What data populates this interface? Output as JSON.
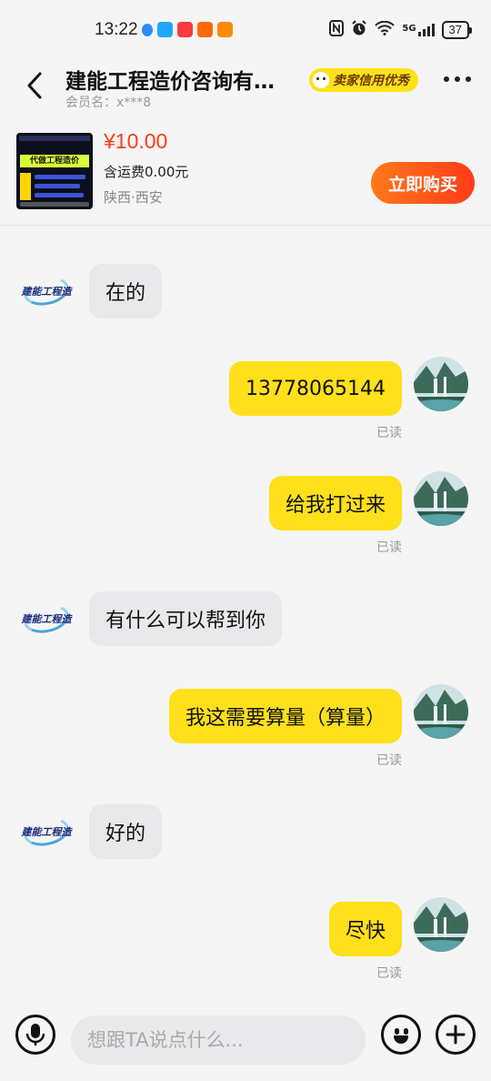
{
  "status_bar": {
    "time": "13:22",
    "battery": "37",
    "network": "5G"
  },
  "header": {
    "shop_name": "建能工程造价咨询有…",
    "credit_badge": "卖家信用优秀",
    "member_label": "会员名：",
    "member_id": "x***8"
  },
  "product": {
    "thumb_title": "代做工程造价",
    "price": "¥10.00",
    "shipping": "含运费0.00元",
    "location": "陕西·西安",
    "buy_label": "立即购买"
  },
  "shop_avatar": {
    "logo_text": "建能工程造"
  },
  "messages": [
    {
      "side": "in",
      "text": "在的"
    },
    {
      "side": "out",
      "text": "13778065144",
      "status": "已读"
    },
    {
      "side": "out",
      "text": "给我打过来",
      "status": "已读"
    },
    {
      "side": "in",
      "text": "有什么可以帮到你"
    },
    {
      "side": "out",
      "text": "我这需要算量（算量）",
      "status": "已读"
    },
    {
      "side": "in",
      "text": "好的"
    },
    {
      "side": "out",
      "text": "尽快",
      "status": "已读"
    }
  ],
  "input": {
    "placeholder": "想跟TA说点什么..."
  },
  "icons": {
    "back": "back-arrow-icon",
    "more": "more-dots-icon",
    "mic": "microphone-icon",
    "emoji": "emoji-icon",
    "plus": "plus-icon"
  },
  "colors": {
    "accent_yellow": "#ffe01a",
    "price_red": "#ff3b1a",
    "buy_gradient_start": "#ff7a1a",
    "incoming_bubble": "#e9e9ec"
  }
}
